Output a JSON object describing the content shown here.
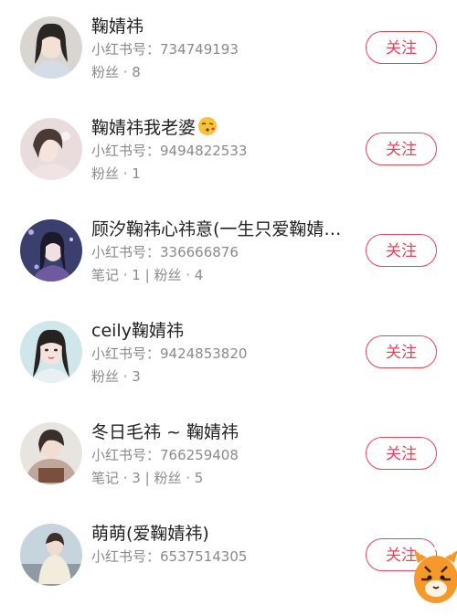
{
  "colors": {
    "accent": "#e3455a",
    "secondary_text": "#8a8a8a",
    "primary_text": "#222222"
  },
  "follow_label": "关注",
  "users": [
    {
      "name": "鞠婧祎",
      "id_line": "小红书号：734749193",
      "stats_line": "粉丝 · 8",
      "avatar_icon": "user-avatar"
    },
    {
      "name": "鞠婧祎我老婆",
      "emoji_icon": "face-blowing-kiss-emoji",
      "id_line": "小红书号：9494822533",
      "stats_line": "粉丝 · 1",
      "avatar_icon": "user-avatar"
    },
    {
      "name": "顾汐鞠祎心祎意(一生只爱鞠婧…",
      "id_line": "小红书号：336666876",
      "stats_line": "笔记 · 1 | 粉丝 · 4",
      "avatar_icon": "user-avatar"
    },
    {
      "name": "ceily鞠婧祎",
      "id_line": "小红书号：9424853820",
      "stats_line": "粉丝 · 3",
      "avatar_icon": "user-avatar"
    },
    {
      "name": "冬日毛祎 ~ 鞠婧祎",
      "id_line": "小红书号：766259408",
      "stats_line": "笔记 · 3 | 粉丝 · 5",
      "avatar_icon": "user-avatar"
    },
    {
      "name": "萌萌(爱鞠婧祎)",
      "id_line": "小红书号：6537514305",
      "stats_line": "",
      "avatar_icon": "user-avatar"
    }
  ],
  "floating_widget": {
    "icon": "tiger-mascot-icon"
  }
}
